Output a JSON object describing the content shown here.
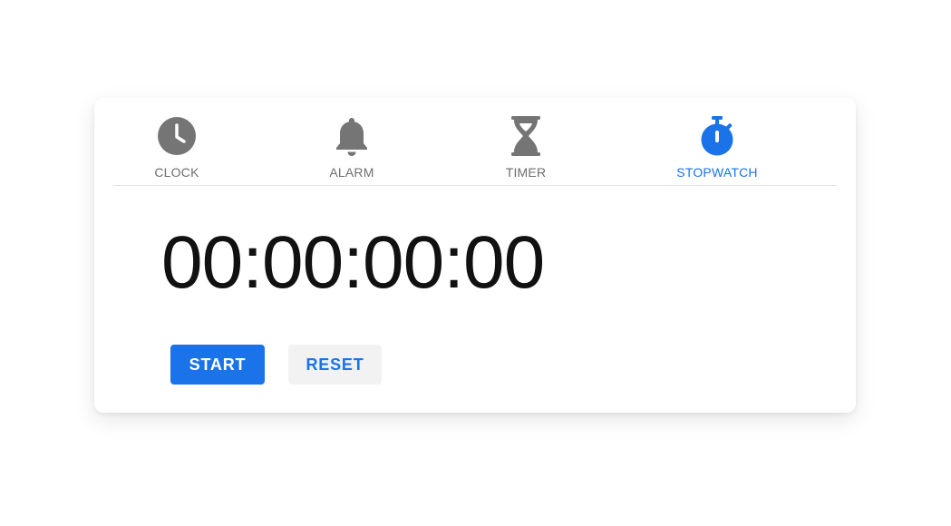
{
  "tabs": [
    {
      "label": "CLOCK",
      "icon": "clock-icon",
      "active": false
    },
    {
      "label": "ALARM",
      "icon": "bell-icon",
      "active": false
    },
    {
      "label": "TIMER",
      "icon": "hourglass-icon",
      "active": false
    },
    {
      "label": "STOPWATCH",
      "icon": "stopwatch-icon",
      "active": true
    }
  ],
  "stopwatch": {
    "time": "00:00:00:00",
    "start_label": "START",
    "reset_label": "RESET"
  },
  "colors": {
    "accent": "#1a73e8",
    "inactive": "#757575",
    "text": "#111111",
    "reset_bg": "#f2f2f2"
  }
}
